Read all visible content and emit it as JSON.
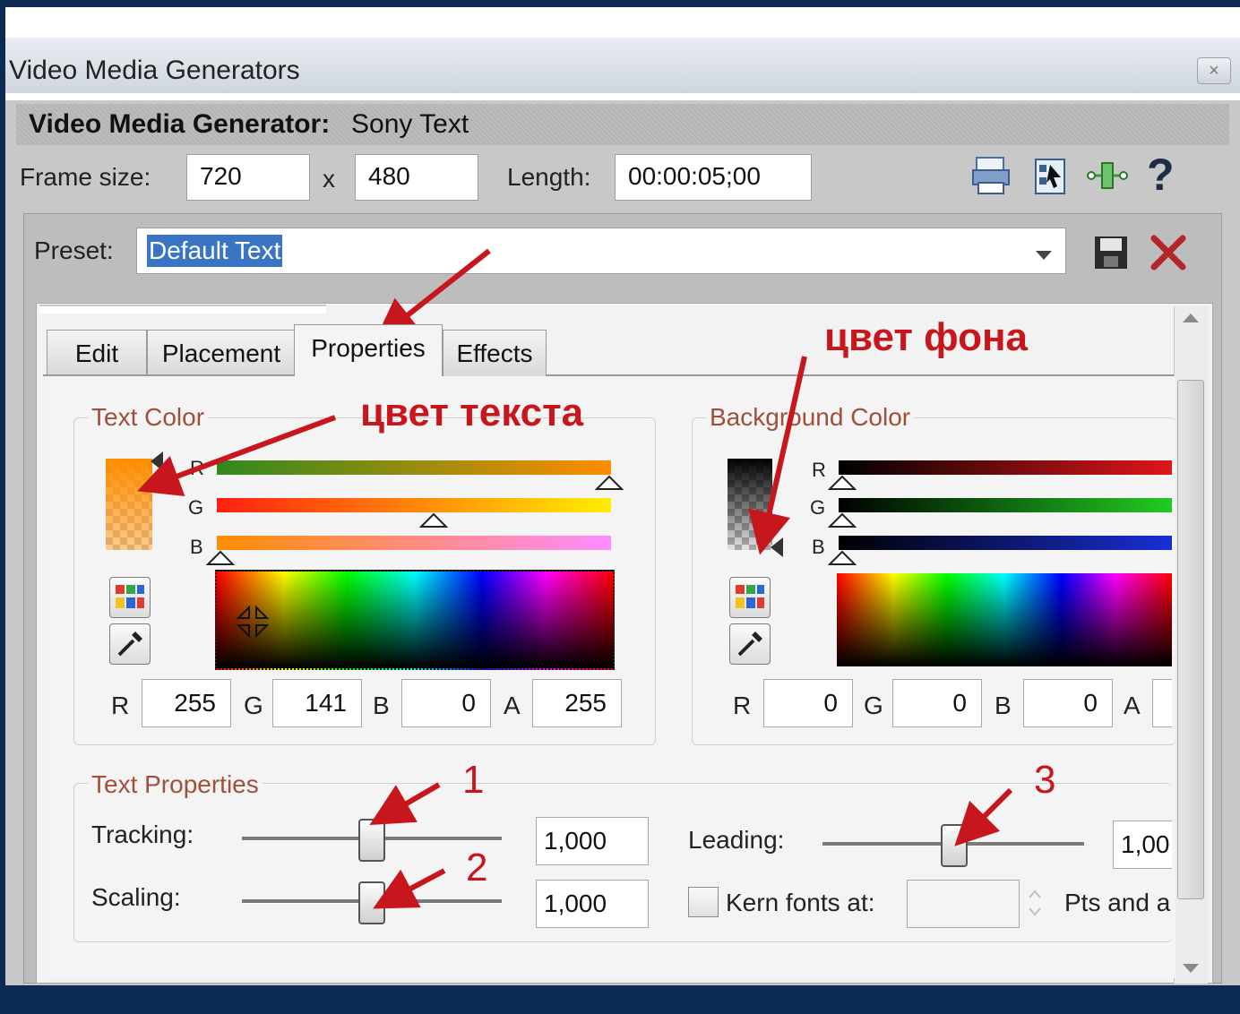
{
  "window": {
    "title": "Video Media Generators",
    "close": "×"
  },
  "generator": {
    "label": "Video Media Generator:",
    "name": "Sony Text"
  },
  "frame": {
    "label": "Frame size:",
    "width": "720",
    "x": "x",
    "height": "480"
  },
  "length": {
    "label": "Length:",
    "value": "00:00:05;00"
  },
  "preset": {
    "label": "Preset:",
    "value": "Default Text"
  },
  "tabs": [
    {
      "label": "Edit"
    },
    {
      "label": "Placement"
    },
    {
      "label": "Properties"
    },
    {
      "label": "Effects"
    }
  ],
  "text_color": {
    "title": "Text Color",
    "channels": [
      "R",
      "G",
      "B"
    ],
    "r_label": "R",
    "r": "255",
    "g_label": "G",
    "g": "141",
    "b_label": "B",
    "b": "0",
    "a_label": "A",
    "a": "255",
    "swatch": "#ff8d00"
  },
  "bg_color": {
    "title": "Background Color",
    "channels": [
      "R",
      "G",
      "B"
    ],
    "r_label": "R",
    "r": "0",
    "g_label": "G",
    "g": "0",
    "b_label": "B",
    "b": "0",
    "a_label": "A"
  },
  "text_properties": {
    "title": "Text Properties",
    "tracking_label": "Tracking:",
    "tracking": "1,000",
    "scaling_label": "Scaling:",
    "scaling": "1,000",
    "leading_label": "Leading:",
    "leading": "1,00",
    "kern_label": "Kern fonts at:",
    "pts_label": "Pts and a"
  },
  "annotations": {
    "text_color": "цвет текста",
    "bg_color": "цвет фона",
    "n1": "1",
    "n2": "2",
    "n3": "3"
  },
  "colors": {
    "annotation": "#c8161d",
    "selection": "#3a75c4",
    "group_title": "#a0503a"
  },
  "icons": [
    "print-icon",
    "film-icon",
    "keyframe-icon",
    "help-icon",
    "save-icon",
    "delete-icon",
    "palette-icon",
    "eyedropper-icon"
  ]
}
